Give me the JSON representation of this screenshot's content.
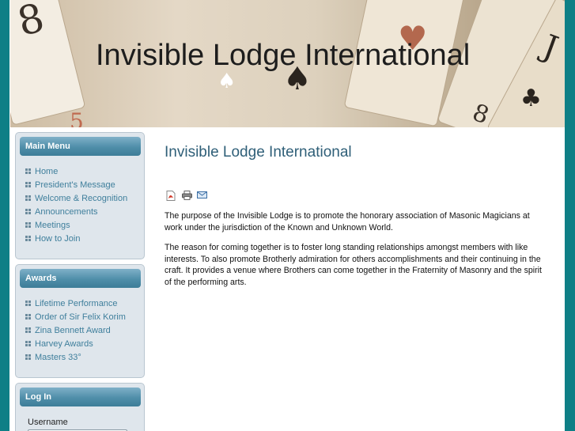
{
  "site": {
    "title": "Invisible Lodge International"
  },
  "main_menu": {
    "heading": "Main Menu",
    "items": [
      {
        "label": "Home"
      },
      {
        "label": "President's Message"
      },
      {
        "label": "Welcome & Recognition"
      },
      {
        "label": "Announcements"
      },
      {
        "label": "Meetings"
      },
      {
        "label": "How to Join"
      }
    ]
  },
  "awards": {
    "heading": "Awards",
    "items": [
      {
        "label": "Lifetime Performance"
      },
      {
        "label": "Order of Sir Felix Korim"
      },
      {
        "label": "Zina Bennett Award"
      },
      {
        "label": "Harvey Awards"
      },
      {
        "label": "Masters 33°"
      }
    ]
  },
  "login": {
    "heading": "Log In",
    "username_label": "Username",
    "username_value": ""
  },
  "article": {
    "title": "Invisible Lodge International",
    "icons": [
      "pdf-icon",
      "print-icon",
      "email-icon"
    ],
    "paragraph1": "The purpose of the Invisible Lodge is to promote the honorary association of Masonic Magicians at work under the jurisdiction of the Known and Unknown World.",
    "paragraph2": "The reason for coming together is to foster long standing relationships amongst members with like interests. To also promote Brotherly admiration for others accomplishments and their continuing in the craft. It provides a venue where Brothers can come together in the Fraternity of Masonry and the spirit of the performing arts."
  },
  "colors": {
    "background": "#0e7f86",
    "module_header": "#4f8ea9",
    "link": "#3f7f9c",
    "article_title": "#2f5f78"
  }
}
